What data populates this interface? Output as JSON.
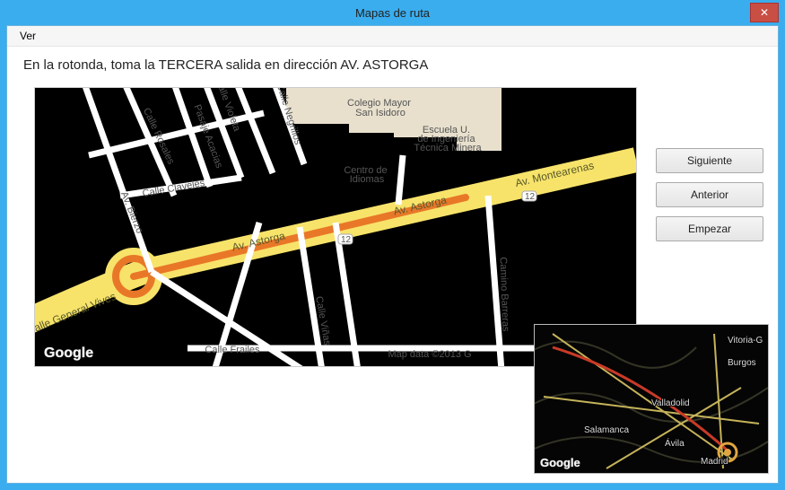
{
  "window": {
    "title": "Mapas de ruta"
  },
  "menubar": {
    "ver": "Ver"
  },
  "instruction": "En la rotonda, toma la TERCERA salida en dirección AV. ASTORGA",
  "buttons": {
    "next": "Siguiente",
    "prev": "Anterior",
    "start": "Empezar"
  },
  "map_main": {
    "roads": {
      "astorga": "Av. Astorga",
      "astorga2": "Av. Astorga",
      "montearenas": "Av. Montearenas",
      "general_vives": "Calle General Vives",
      "bierzo": "Av. Bierzo",
      "rosales": "Calle Rosales",
      "acacias": "Pasaje Acacias",
      "violeta": "Calle Violeta",
      "negrillos": "Calle Negrillos",
      "claveles": "Calle Claveles",
      "frailes": "Calle Frailes",
      "vinas": "Calle Viñas",
      "barreras": "Camino Barreras"
    },
    "pois": {
      "colegio": "Colegio Mayor\nSan Isidoro",
      "escuela": "Escuela U.\nde Ingeniería\nTécnica Minera",
      "centro": "Centro de\nIdiomas"
    },
    "badge12": "12",
    "branding": "Google",
    "attribution_partial": "Map data ©2013 G"
  },
  "map_mini": {
    "cities": {
      "madrid": "Madrid",
      "valladolid": "Valladolid",
      "salamanca": "Salamanca",
      "avila": "Ávila",
      "burgos": "Burgos",
      "vitoria": "Vitoria-G"
    },
    "branding": "Google"
  }
}
